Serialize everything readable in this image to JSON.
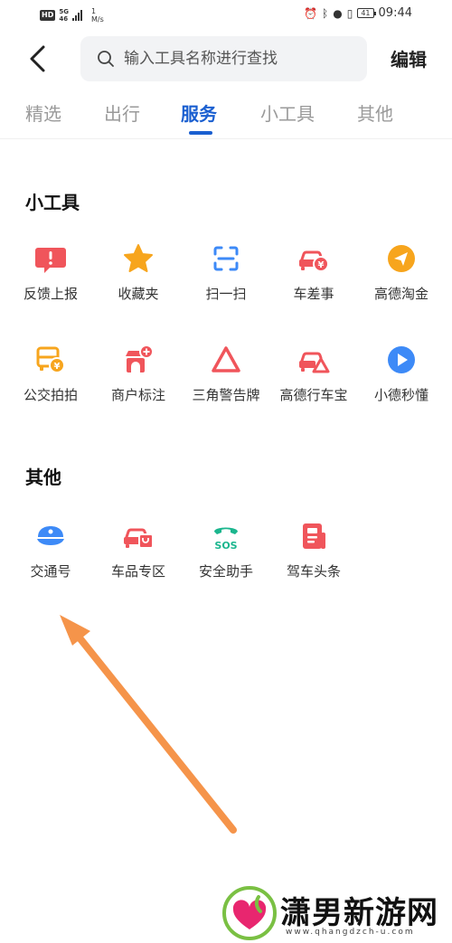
{
  "status_bar": {
    "hd": "HD",
    "net_gen": "5G",
    "net_sub": "46",
    "speed_value": "1",
    "speed_unit": "M/s",
    "battery": "41",
    "time": "09:44"
  },
  "header": {
    "search_placeholder": "输入工具名称进行查找",
    "edit_label": "编辑"
  },
  "tabs": [
    {
      "label": "精选"
    },
    {
      "label": "出行"
    },
    {
      "label": "服务",
      "active": true
    },
    {
      "label": "小工具"
    },
    {
      "label": "其他"
    }
  ],
  "sections": [
    {
      "title": "小工具",
      "items": [
        {
          "label": "反馈上报",
          "icon": "feedback-report-icon"
        },
        {
          "label": "收藏夹",
          "icon": "star-icon"
        },
        {
          "label": "扫一扫",
          "icon": "scan-icon"
        },
        {
          "label": "车差事",
          "icon": "car-yen-icon"
        },
        {
          "label": "高德淘金",
          "icon": "gold-send-icon"
        },
        {
          "label": "公交拍拍",
          "icon": "bus-yen-icon"
        },
        {
          "label": "商户标注",
          "icon": "shop-add-icon"
        },
        {
          "label": "三角警告牌",
          "icon": "warning-triangle-icon"
        },
        {
          "label": "高德行车宝",
          "icon": "car-triangle-icon"
        },
        {
          "label": "小德秒懂",
          "icon": "play-icon"
        }
      ]
    },
    {
      "title": "其他",
      "items": [
        {
          "label": "交通号",
          "icon": "police-cap-icon"
        },
        {
          "label": "车品专区",
          "icon": "car-shop-icon"
        },
        {
          "label": "安全助手",
          "icon": "sos-phone-icon"
        },
        {
          "label": "驾车头条",
          "icon": "news-icon"
        }
      ]
    }
  ],
  "colors": {
    "accent": "#1a5fd0",
    "red": "#f0555b",
    "orange": "#f7a51d",
    "blue": "#3d8af7",
    "green": "#1bb68e",
    "arrow": "#f5944a"
  },
  "watermark": {
    "text": "潇男新游网",
    "url": "www.qhangdzch-u.com"
  }
}
